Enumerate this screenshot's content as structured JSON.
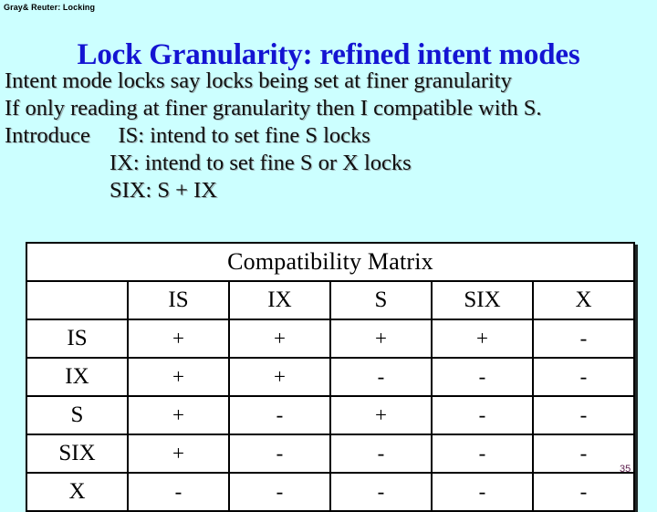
{
  "header": {
    "running_title": "Gray& Reuter: Locking"
  },
  "title": "Lock Granularity: refined intent modes",
  "body_lines": [
    {
      "text": "Intent mode locks say locks being set at finer granularity",
      "indent": 0
    },
    {
      "text": "If only reading at finer granularity then I compatible with S.",
      "indent": 0
    },
    {
      "text": "Introduce     IS: intend to set fine S locks",
      "indent": 0
    },
    {
      "text": "IX: intend to set fine S or X locks",
      "indent": 1
    },
    {
      "text": "SIX: S + IX",
      "indent": 1
    }
  ],
  "matrix": {
    "caption": "Compatibility Matrix",
    "corner": "",
    "columns": [
      "IS",
      "IX",
      "S",
      "SIX",
      "X"
    ],
    "rows": [
      {
        "label": "IS",
        "cells": [
          "+",
          "+",
          "+",
          "+",
          "-"
        ]
      },
      {
        "label": "IX",
        "cells": [
          "+",
          "+",
          "-",
          "-",
          "-"
        ]
      },
      {
        "label": "S",
        "cells": [
          "+",
          "-",
          "+",
          "-",
          "-"
        ]
      },
      {
        "label": "SIX",
        "cells": [
          "+",
          "-",
          "-",
          "-",
          "-"
        ]
      },
      {
        "label": "X",
        "cells": [
          "-",
          "-",
          "-",
          "-",
          "-"
        ]
      }
    ],
    "yes_symbol": "+",
    "no_symbol": "-",
    "colors": {
      "compatible_bg": "#ccffcc",
      "incompatible_bg": "#fbd2fb",
      "header_bg": "#ffffff",
      "border": "#000000"
    }
  },
  "page_number": "35",
  "colors": {
    "background": "#ccffff",
    "title": "#1414d2",
    "body_text": "#111111",
    "page_number": "#5a1a4a"
  }
}
